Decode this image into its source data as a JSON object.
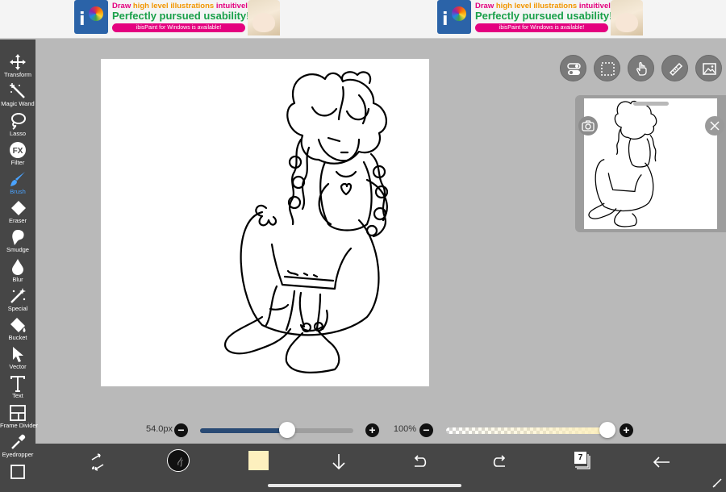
{
  "ads": [
    {
      "line1_prefix": "Draw ",
      "line1_highlight": "high level illustrations",
      "line1_suffix": " intuitively!",
      "line2": "Perfectly pursued usability!",
      "line3": "ibisPaint for Windows is available!"
    },
    {
      "line1_prefix": "Draw ",
      "line1_highlight": "high level illustrations",
      "line1_suffix": " intuitively!",
      "line2": "Perfectly pursued usability!",
      "line3": "ibisPaint for Windows is available!"
    }
  ],
  "toolbar": {
    "active": "brush",
    "items": [
      {
        "id": "transform",
        "label": "Transform",
        "icon": "move-icon"
      },
      {
        "id": "magic-wand",
        "label": "Magic Wand",
        "icon": "magic-wand-icon"
      },
      {
        "id": "lasso",
        "label": "Lasso",
        "icon": "lasso-icon"
      },
      {
        "id": "filter",
        "label": "Filter",
        "icon": "fx-icon"
      },
      {
        "id": "brush",
        "label": "Brush",
        "icon": "brush-icon"
      },
      {
        "id": "eraser",
        "label": "Eraser",
        "icon": "eraser-icon"
      },
      {
        "id": "smudge",
        "label": "Smudge",
        "icon": "smudge-icon"
      },
      {
        "id": "blur",
        "label": "Blur",
        "icon": "drop-icon"
      },
      {
        "id": "special",
        "label": "Special",
        "icon": "sparkle-icon"
      },
      {
        "id": "bucket",
        "label": "Bucket",
        "icon": "bucket-icon"
      },
      {
        "id": "vector",
        "label": "Vector",
        "icon": "cursor-icon"
      },
      {
        "id": "text",
        "label": "Text",
        "icon": "text-icon"
      },
      {
        "id": "frame-divider",
        "label": "Frame Divider",
        "icon": "frame-icon"
      },
      {
        "id": "eyedropper",
        "label": "Eyedropper",
        "icon": "eyedropper-icon"
      }
    ]
  },
  "top_buttons": [
    "toggle-icon",
    "selection-icon",
    "hand-icon",
    "ruler-icon",
    "image-icon"
  ],
  "sliders": {
    "brush_size_label": "54.0px",
    "brush_size_fraction": 0.57,
    "opacity_label": "100%",
    "opacity_fraction": 1.0
  },
  "bottom_bar": {
    "primary_color": "#fdf0be",
    "layer_count": "7",
    "icons": [
      "swap-icon",
      "brush-preview-icon",
      "color-swatch-icon",
      "download-icon",
      "undo-icon",
      "redo-icon",
      "layers-icon",
      "back-icon"
    ]
  },
  "colors": {
    "toolbar_bg": "#464646",
    "workspace_bg": "#b9b9b9",
    "accent_blue": "#4aa3ff",
    "size_fill": "#294a74"
  }
}
